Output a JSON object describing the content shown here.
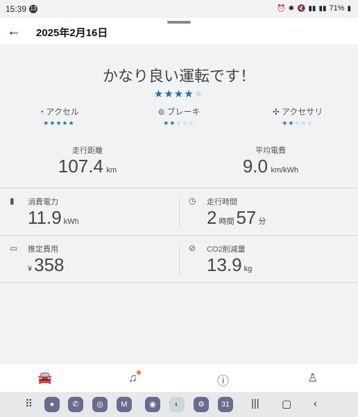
{
  "status": {
    "time": "15:39",
    "notif_count": "13",
    "battery": "71%"
  },
  "appbar": {
    "title": "2025年2月16日"
  },
  "rating": {
    "headline": "かなり良い運転です！",
    "overall_stars": 4,
    "categories": [
      {
        "label": "アクセル",
        "stars": 5
      },
      {
        "label": "ブレーキ",
        "stars": 2
      },
      {
        "label": "アクセサリ",
        "stars": 2
      }
    ]
  },
  "metrics": {
    "distance": {
      "label": "走行距離",
      "value": "107.4",
      "unit": "km"
    },
    "efficiency": {
      "label": "平均電費",
      "value": "9.0",
      "unit": "km/kWh"
    }
  },
  "cells": {
    "energy": {
      "label": "消費電力",
      "value": "11.9",
      "unit": "kWh"
    },
    "time": {
      "label": "走行時間",
      "hours": "2",
      "hours_unit": "時間",
      "minutes": "57",
      "minutes_unit": "分"
    },
    "cost": {
      "label": "推定費用",
      "currency": "¥",
      "value": "358"
    },
    "co2": {
      "label": "CO2削減量",
      "value": "13.9",
      "unit": "kg"
    }
  },
  "taskbar": {
    "calendar_day": "31"
  }
}
